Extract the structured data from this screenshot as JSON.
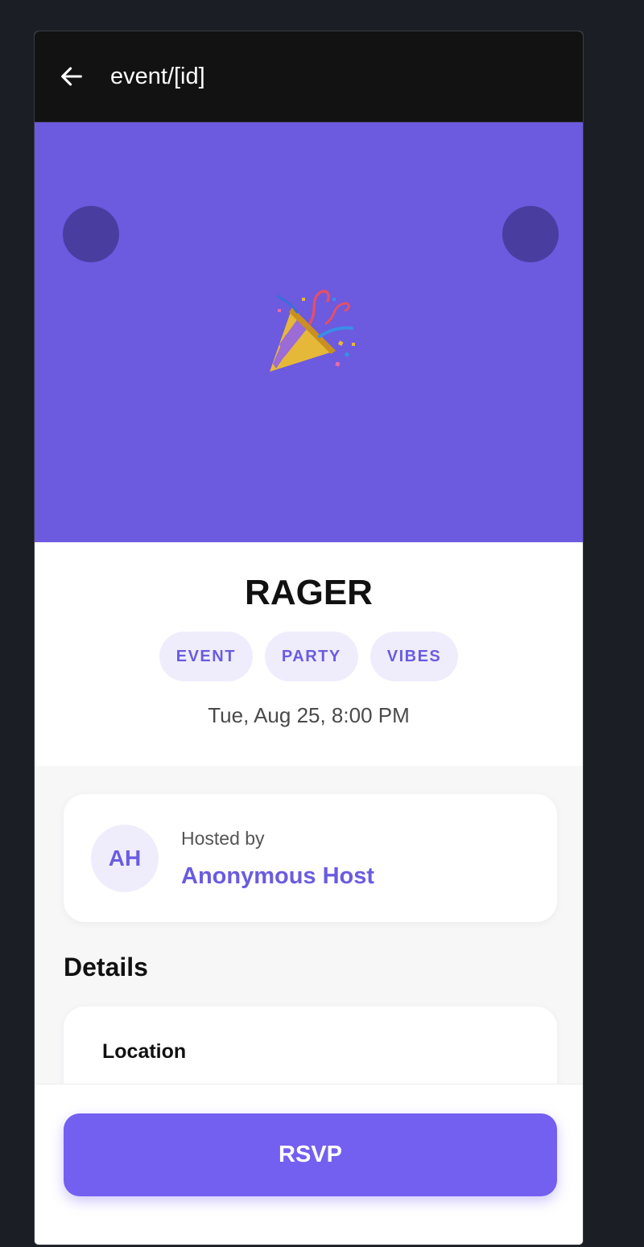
{
  "header": {
    "back_icon": "arrow-left-icon",
    "title": "event/[id]"
  },
  "hero": {
    "background_color": "#6c5adf",
    "emoji": "party-popper-icon"
  },
  "event": {
    "title": "RAGER",
    "tags": [
      "EVENT",
      "PARTY",
      "VIBES"
    ],
    "date": "Tue, Aug 25, 8:00 PM"
  },
  "host": {
    "initials": "AH",
    "label": "Hosted by",
    "name": "Anonymous Host"
  },
  "details": {
    "heading": "Details",
    "location_label": "Location"
  },
  "footer": {
    "rsvp_label": "RSVP"
  },
  "colors": {
    "accent": "#735ff0",
    "accent_text": "#6a5ce0",
    "tag_bg": "#efedfc"
  }
}
